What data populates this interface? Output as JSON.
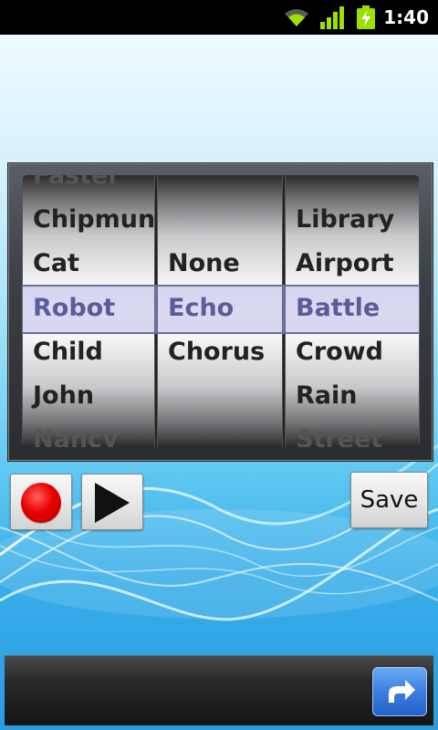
{
  "status_bar": {
    "time": "1:40",
    "icons": [
      "wifi-icon",
      "signal-icon",
      "battery-charging-icon"
    ]
  },
  "picker": {
    "voices": [
      "Faster",
      "Chipmun",
      "Cat",
      "Robot",
      "Child",
      "John",
      "Nancy"
    ],
    "effects": [
      "",
      "",
      "None",
      "Echo",
      "Chorus",
      "",
      ""
    ],
    "places": [
      "",
      "Library",
      "Airport",
      "Battle",
      "Crowd",
      "Rain",
      "Street"
    ],
    "selected": {
      "voice": "Robot",
      "effect": "Echo",
      "place": "Battle"
    }
  },
  "controls": {
    "record_icon": "record-icon",
    "play_icon": "play-icon",
    "save_label": "Save"
  },
  "bottom_bar": {
    "share_icon": "share-arrow-icon"
  },
  "colors": {
    "record_red": "#e80000",
    "selector_tint": "#9696dc",
    "share_blue": "#3a7fe0"
  }
}
